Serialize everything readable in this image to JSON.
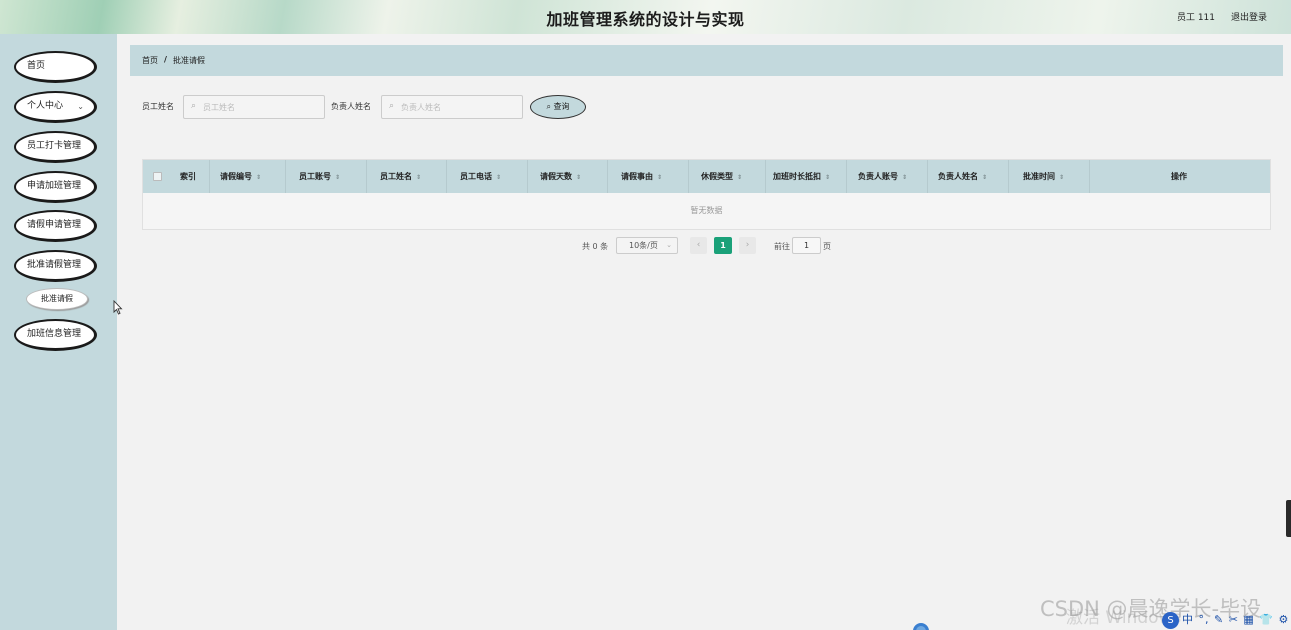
{
  "header": {
    "title": "加班管理系统的设计与实现",
    "user": "员工 111",
    "logout": "退出登录"
  },
  "sidebar": {
    "items": [
      {
        "label": "首页"
      },
      {
        "label": "个人中心",
        "icon": "chevron-down-icon"
      },
      {
        "label": "员工打卡管理"
      },
      {
        "label": "申请加班管理"
      },
      {
        "label": "请假申请管理"
      },
      {
        "label": "批准请假管理"
      },
      {
        "label": "批准请假",
        "sub": true
      },
      {
        "label": "加班信息管理"
      }
    ]
  },
  "breadcrumb": {
    "home": "首页",
    "separator": "/",
    "current": "批准请假"
  },
  "search": {
    "employee_label": "员工姓名",
    "employee_placeholder": "员工姓名",
    "manager_label": "负责人姓名",
    "manager_placeholder": "负责人姓名",
    "query_button": "查询"
  },
  "table": {
    "columns": [
      "索引",
      "请假编号",
      "员工账号",
      "员工姓名",
      "员工电话",
      "请假天数",
      "请假事由",
      "休假类型",
      "加班时长抵扣",
      "负责人账号",
      "负责人姓名",
      "批准时间",
      "操作"
    ],
    "rows": [],
    "empty_text": "暂无数据"
  },
  "pagination": {
    "total": "共 0 条",
    "page_size": "10条/页",
    "prev": "‹",
    "current_page": "1",
    "next": "›",
    "goto_label": "前往",
    "goto_value": "1",
    "page_suffix": "页"
  },
  "overlay": {
    "watermark_csdn": "CSDN @晨逸学长-毕设",
    "watermark_windows": "激活 Windows",
    "ime_logo": "S",
    "ime_text": "中 °, ✎ ✂ ▦ 👕 ⚙"
  },
  "colors": {
    "accent": "#c3d9dd",
    "active_page": "#1aa179",
    "background": "#f2f2f2"
  }
}
